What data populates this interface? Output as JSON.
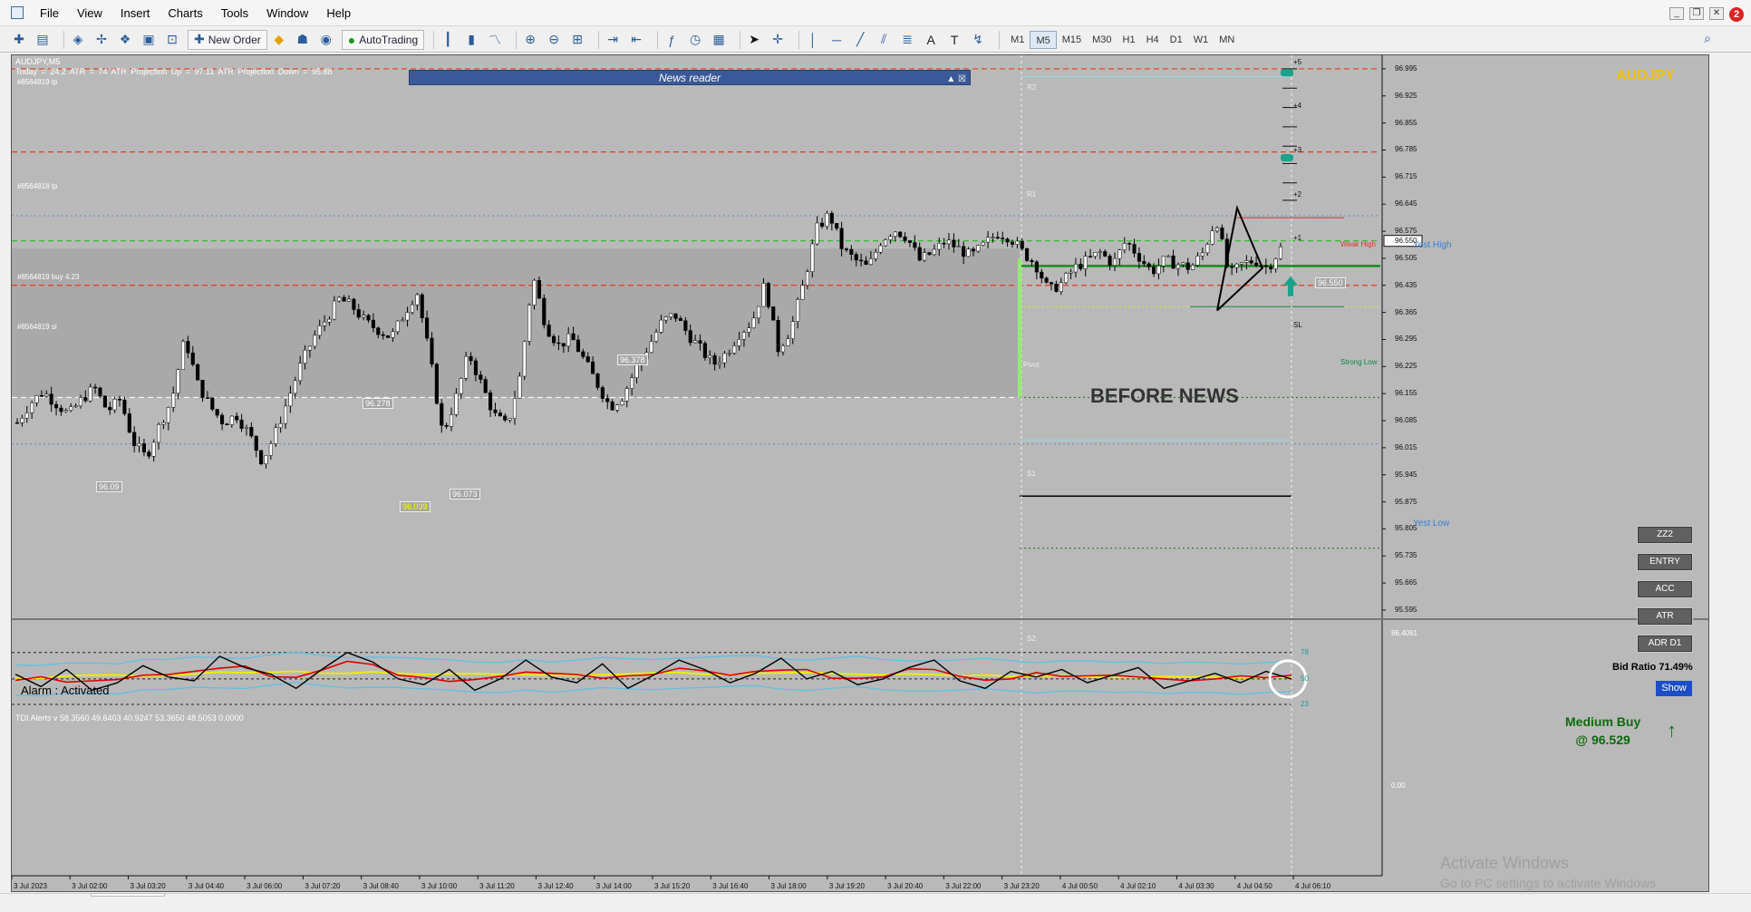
{
  "menu": [
    "File",
    "View",
    "Insert",
    "Charts",
    "Tools",
    "Window",
    "Help"
  ],
  "window_controls": {
    "badge": "2"
  },
  "toolbar": {
    "new_order": "New Order",
    "autotrading": "AutoTrading",
    "timeframes": [
      "M1",
      "M5",
      "M15",
      "M30",
      "H1",
      "H4",
      "D1",
      "W1",
      "MN"
    ],
    "active_timeframe": "M5"
  },
  "chart": {
    "symbol_title": "AUDJPY,M5",
    "stats": "Today = 24.2    ATR = 74    ATR Projection Up = 97.11    ATR Projection Down = 95.88",
    "news_reader": "News reader",
    "before_news": "BEFORE NEWS",
    "symbol_watermark": "AUDJPY",
    "alarm": "Alarm : Activated",
    "bid_ratio": "Bid Ratio 71.49%",
    "show_label": "Show",
    "medium_buy": "Medium Buy",
    "medium_buy_price": "@ 96.529",
    "indicator_buttons": [
      "ZZ2",
      "ENTRY",
      "ACC",
      "ATR",
      "ADR D1"
    ],
    "tdi_title": "TDI Alerts v 58.3560 49.6403 40.9247 53.3650 48.5053 0.0000",
    "activate_windows": "Activate Windows",
    "activate_windows_sub": "Go to PC settings to activate Windows",
    "order_labels": [
      "#8564819 tp",
      "#8564818 tp",
      "#8564819 buy 4.23",
      "#8564819 sl"
    ],
    "zone_labels": [
      "Weak High",
      "Yest High",
      "Strong Low",
      "Yest Low",
      "Pivot",
      "R1",
      "R2",
      "S1",
      "S2"
    ],
    "fib_labels": [
      "+5",
      "+4",
      "+3",
      "+2",
      "+1",
      "SL"
    ],
    "price_tags": [
      "96.09",
      "96.278",
      "96.039",
      "96.073",
      "96.378",
      "96.550"
    ],
    "price_axis": [
      "96.995",
      "96.925",
      "96.855",
      "96.785",
      "96.715",
      "96.645",
      "96.575",
      "96.505",
      "96.435",
      "96.365",
      "96.295",
      "96.225",
      "96.155",
      "96.085",
      "96.015",
      "95.945",
      "95.875",
      "95.805",
      "95.735",
      "95.665",
      "95.595"
    ],
    "price_current": "96.550",
    "tdi_axis": [
      "86.4091",
      "78",
      "50",
      "23",
      "0.00"
    ],
    "time_axis": [
      "3 Jul 2023",
      "3 Jul 02:00",
      "3 Jul 03:20",
      "3 Jul 04:40",
      "3 Jul 06:00",
      "3 Jul 07:20",
      "3 Jul 08:40",
      "3 Jul 10:00",
      "3 Jul 11:20",
      "3 Jul 12:40",
      "3 Jul 14:00",
      "3 Jul 15:20",
      "3 Jul 16:40",
      "3 Jul 18:00",
      "3 Jul 19:20",
      "3 Jul 20:40",
      "3 Jul 22:00",
      "3 Jul 23:20",
      "4 Jul 00:50",
      "4 Jul 02:10",
      "4 Jul 03:30",
      "4 Jul 04:50",
      "4 Jul 06:10"
    ]
  },
  "colors": {
    "bull": "#ffffff",
    "bear": "#000000",
    "rsi": "#e00000",
    "signal": "#f0f000",
    "band": "#5bc0e6",
    "tp": "#e53b1e",
    "buy": "#22c022",
    "highlight": "#90ee70"
  },
  "chart_data": {
    "type": "candlestick",
    "symbol": "AUDJPY",
    "timeframe": "M5",
    "ylim": [
      95.595,
      97.03
    ],
    "x_range": [
      "3 Jul 2023",
      "4 Jul 06:10"
    ],
    "current_price": 96.55,
    "orders": [
      {
        "label": "#8564819 tp",
        "price": 96.995
      },
      {
        "label": "#8564818 tp",
        "price": 96.78
      },
      {
        "label": "#8564819 buy 4.23",
        "price": 96.55
      },
      {
        "label": "#8564819 sl",
        "price": 96.435
      }
    ],
    "close_series": [
      96.08,
      96.13,
      96.16,
      96.13,
      96.1,
      96.14,
      96.17,
      96.11,
      96.14,
      96.03,
      95.99,
      96.07,
      96.14,
      96.3,
      96.18,
      96.12,
      96.08,
      96.1,
      96.05,
      95.98,
      96.05,
      96.14,
      96.23,
      96.3,
      96.35,
      96.4,
      96.38,
      96.34,
      96.32,
      96.3,
      96.36,
      96.42,
      96.25,
      96.05,
      96.14,
      96.26,
      96.18,
      96.1,
      96.07,
      96.2,
      96.46,
      96.33,
      96.28,
      96.3,
      96.24,
      96.18,
      96.12,
      96.15,
      96.22,
      96.28,
      96.34,
      96.36,
      96.31,
      96.27,
      96.23,
      96.26,
      96.31,
      96.34,
      96.44,
      96.27,
      96.32,
      96.44,
      96.58,
      96.62,
      96.53,
      96.5,
      96.48,
      96.55,
      96.58,
      96.56,
      96.5,
      96.52,
      96.55,
      96.53,
      96.51,
      96.54,
      96.57,
      96.56,
      96.52,
      96.49,
      96.42,
      96.44,
      96.48,
      96.5,
      96.52,
      96.49,
      96.55,
      96.51,
      96.47,
      96.5,
      96.49,
      96.48,
      96.52,
      96.61,
      96.46,
      96.49,
      96.5,
      96.48,
      96.53
    ],
    "tdi": {
      "ylim": [
        0,
        86.4091
      ],
      "levels": [
        78,
        50,
        23
      ],
      "rsi_price": [
        55,
        42,
        60,
        38,
        46,
        64,
        52,
        48,
        74,
        62,
        55,
        40,
        60,
        78,
        68,
        50,
        44,
        60,
        38,
        50,
        70,
        52,
        46,
        66,
        40,
        54,
        70,
        60,
        46,
        56,
        72,
        50,
        58,
        44,
        50,
        62,
        70,
        48,
        40,
        58,
        52,
        60,
        46,
        54,
        62,
        40,
        48,
        56,
        46,
        58,
        50
      ]
    }
  }
}
